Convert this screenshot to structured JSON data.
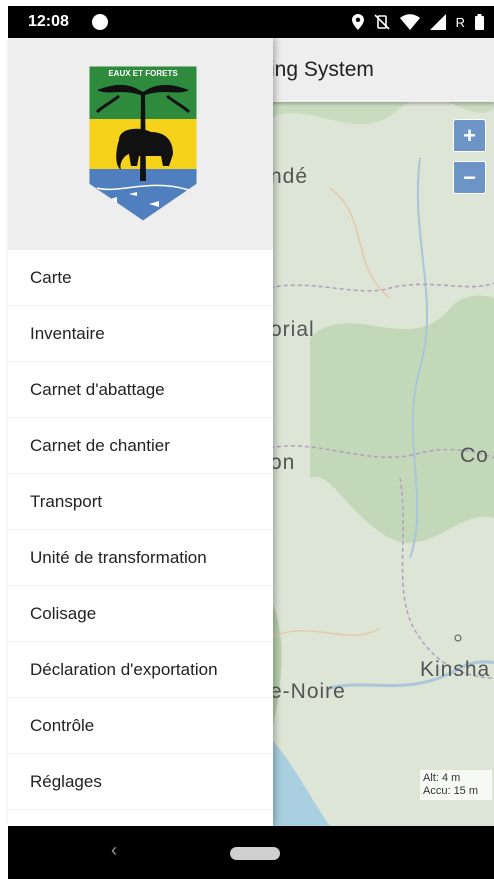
{
  "status_bar": {
    "time": "12:08",
    "icons": [
      "location-icon",
      "vibrate-off-icon",
      "wifi-icon",
      "signal-icon",
      "roaming-icon",
      "battery-icon"
    ],
    "roaming_label": "R"
  },
  "app_bar": {
    "title_partial": "ing System"
  },
  "drawer": {
    "logo_text": "EAUX ET FORETS",
    "items": [
      {
        "label": "Carte"
      },
      {
        "label": "Inventaire"
      },
      {
        "label": "Carnet d'abattage"
      },
      {
        "label": "Carnet de chantier"
      },
      {
        "label": "Transport"
      },
      {
        "label": "Unité de transformation"
      },
      {
        "label": "Colisage"
      },
      {
        "label": "Déclaration d'exportation"
      },
      {
        "label": "Contrôle"
      },
      {
        "label": "Réglages"
      }
    ]
  },
  "map": {
    "zoom_in_label": "+",
    "zoom_out_label": "−",
    "labels": [
      "ndé",
      "orial",
      "on",
      "Co",
      "Kinsha",
      "e-Noire"
    ],
    "altitude_text": "Alt: 4 m",
    "accuracy_text": "Accu: 15 m"
  },
  "colors": {
    "drawer_header": "#eeeeee",
    "zoom_button": "#6d94c7",
    "emblem_green": "#2e8b3e",
    "emblem_yellow": "#f6d21b",
    "emblem_blue": "#4f7fbf"
  },
  "nav_bar": {
    "back_icon": "back-chevron-icon",
    "home_icon": "home-pill-icon"
  }
}
